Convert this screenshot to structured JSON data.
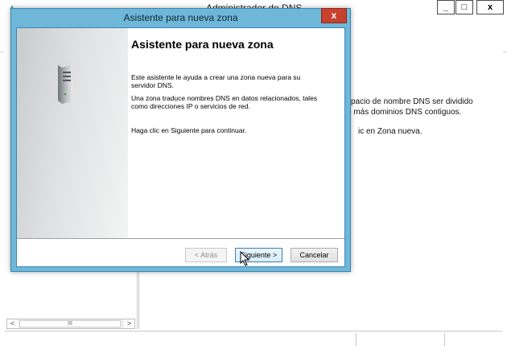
{
  "background_window": {
    "title": "Administrador de DNS",
    "controls": {
      "minimize": "_",
      "maximize": "□",
      "close": "x"
    },
    "right_pane_lines": [
      "spacio de nombre DNS ser dividido",
      "o más dominios DNS contiguos.",
      "ic en Zona nueva."
    ],
    "scrollbar": {
      "left_arrow": "<",
      "thumb": "III",
      "right_arrow": ">"
    }
  },
  "wizard": {
    "window_title": "Asistente para nueva zona",
    "close_label": "x",
    "heading": "Asistente para nueva zona",
    "paragraphs": [
      "Este asistente le ayuda a crear una zona nueva para su servidor DNS.",
      "Una zona traduce nombres DNS en datos relacionados, tales como direcciones IP o servicios de red.",
      "Haga clic en Siguiente para continuar."
    ],
    "buttons": {
      "back": "< Atrás",
      "next": "Siguiente >",
      "cancel": "Cancelar"
    },
    "icon": "server-icon"
  },
  "colors": {
    "wizard_frame": "#6fb7d9",
    "close_button": "#c7412d"
  }
}
